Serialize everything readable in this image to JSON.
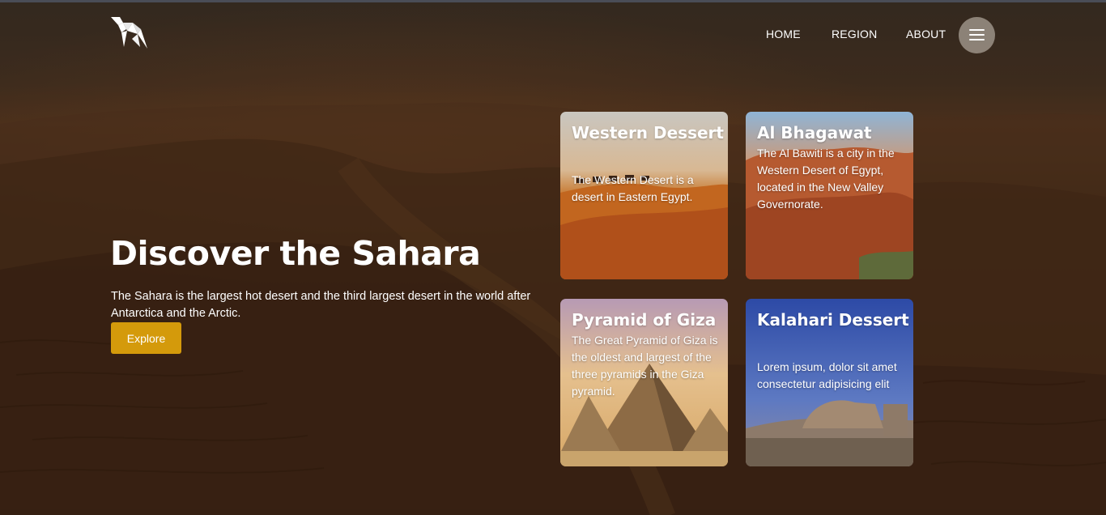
{
  "nav": {
    "logo_icon": "origami-bird-logo",
    "links": [
      {
        "label": "HOME"
      },
      {
        "label": "REGION"
      },
      {
        "label": "ABOUT"
      }
    ],
    "menu_icon": "hamburger-menu-icon"
  },
  "hero": {
    "title": "Discover the Sahara",
    "description": "The Sahara is the largest hot desert and the third largest desert in the world after Antarctica and the Arctic.",
    "button_label": "Explore"
  },
  "cards": [
    {
      "title": "Western Dessert",
      "text": "The Western Desert is a desert in Eastern Egypt."
    },
    {
      "title": "Al Bhagawat",
      "text": "The Al Bawiti is a city in the Western Desert of Egypt, located in the New Valley Governorate."
    },
    {
      "title": "Pyramid of Giza",
      "text": "The Great Pyramid of Giza is the oldest and largest of the three pyramids in the Giza pyramid."
    },
    {
      "title": "Kalahari Dessert",
      "text": "Lorem ipsum, dolor sit amet consectetur adipisicing elit"
    }
  ],
  "colors": {
    "accent_button": "#d49a0b",
    "nav_text": "#ffffff",
    "menu_circle": "#aaa096"
  }
}
